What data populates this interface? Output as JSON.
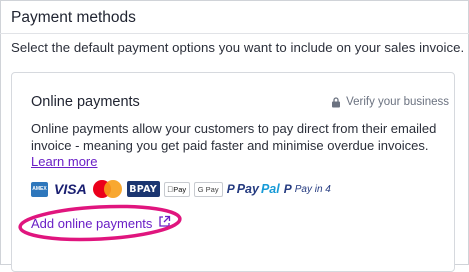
{
  "section": {
    "title": "Payment methods",
    "description": "Select the default payment options you want to include on your sales invoice."
  },
  "online_payments": {
    "title": "Online payments",
    "verify_label": "Verify your business",
    "description": "Online payments allow your customers to pay direct from their emailed invoice - meaning you get paid faster and minimise overdue invoices.",
    "learn_more": "Learn more",
    "add_link": "Add online payments",
    "logos": {
      "amex": "AMEX",
      "visa": "VISA",
      "mastercard": "mastercard",
      "bpay": "BPAY",
      "apple_pay": "Pay",
      "google_pay": "G Pay",
      "paypal_a": "Pay",
      "paypal_b": "Pal",
      "pay_in_4": "Pay in 4"
    }
  },
  "colors": {
    "link": "#6a1fc6",
    "highlight": "#e0157e",
    "border": "#d6d9de"
  }
}
